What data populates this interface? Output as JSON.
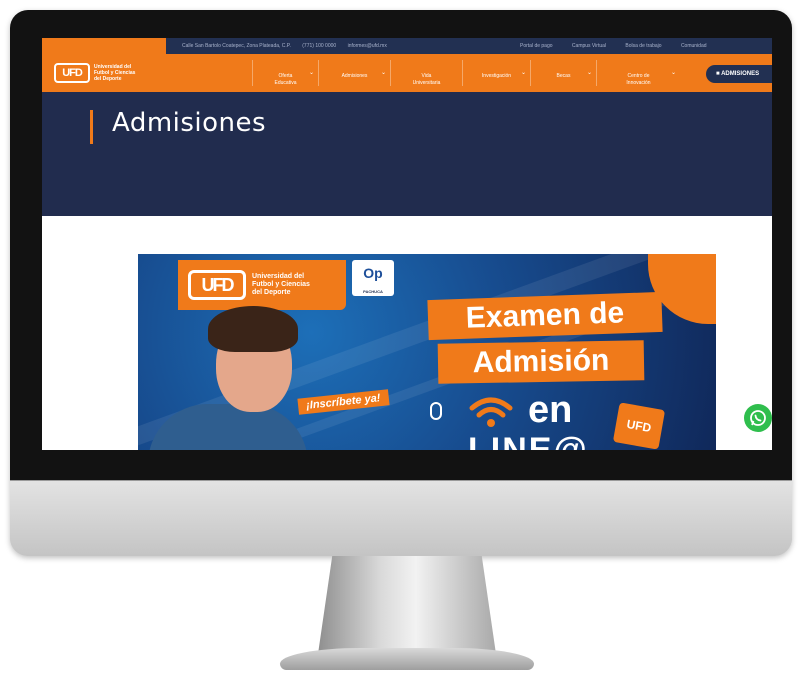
{
  "topbar": {
    "contact": [
      "Calle San Bartolo Coatepec, Zona Plateada, C.P.",
      "(771) 100 0000",
      "informes@ufd.mx"
    ],
    "quick_links": [
      "Portal de pago",
      "Campus Virtual",
      "Bolsa de trabajo",
      "Comunidad"
    ]
  },
  "brand": {
    "mark": "UFD",
    "name": "Universidad del\nFutbol y Ciencias\ndel Deporte"
  },
  "nav": {
    "items": [
      "Oferta\nEducativa",
      "Admisiones",
      "Vida\nUniversitaria",
      "Investigación",
      "Becas",
      "Centro de\nInnovación"
    ],
    "admin_button": "ADMISIONES"
  },
  "hero": {
    "title": "Admisiones"
  },
  "banner": {
    "logo_mark": "UFD",
    "logo_text": "Universidad del\nFutbol y Ciencias\ndel Deporte",
    "partner_mark": "Op",
    "partner_text": "PACHUCA",
    "cta": "¡Inscríbete ya!",
    "headline_1": "Examen de",
    "headline_2": "Admisión",
    "headline_3": "en",
    "headline_4": "LINE@",
    "card_mark": "UFD"
  },
  "colors": {
    "orange": "#f07a1a",
    "navy": "#212c4e",
    "whatsapp": "#2fbe4d"
  },
  "icons": {
    "chat": "whatsapp-icon",
    "lock": "admin-icon"
  }
}
